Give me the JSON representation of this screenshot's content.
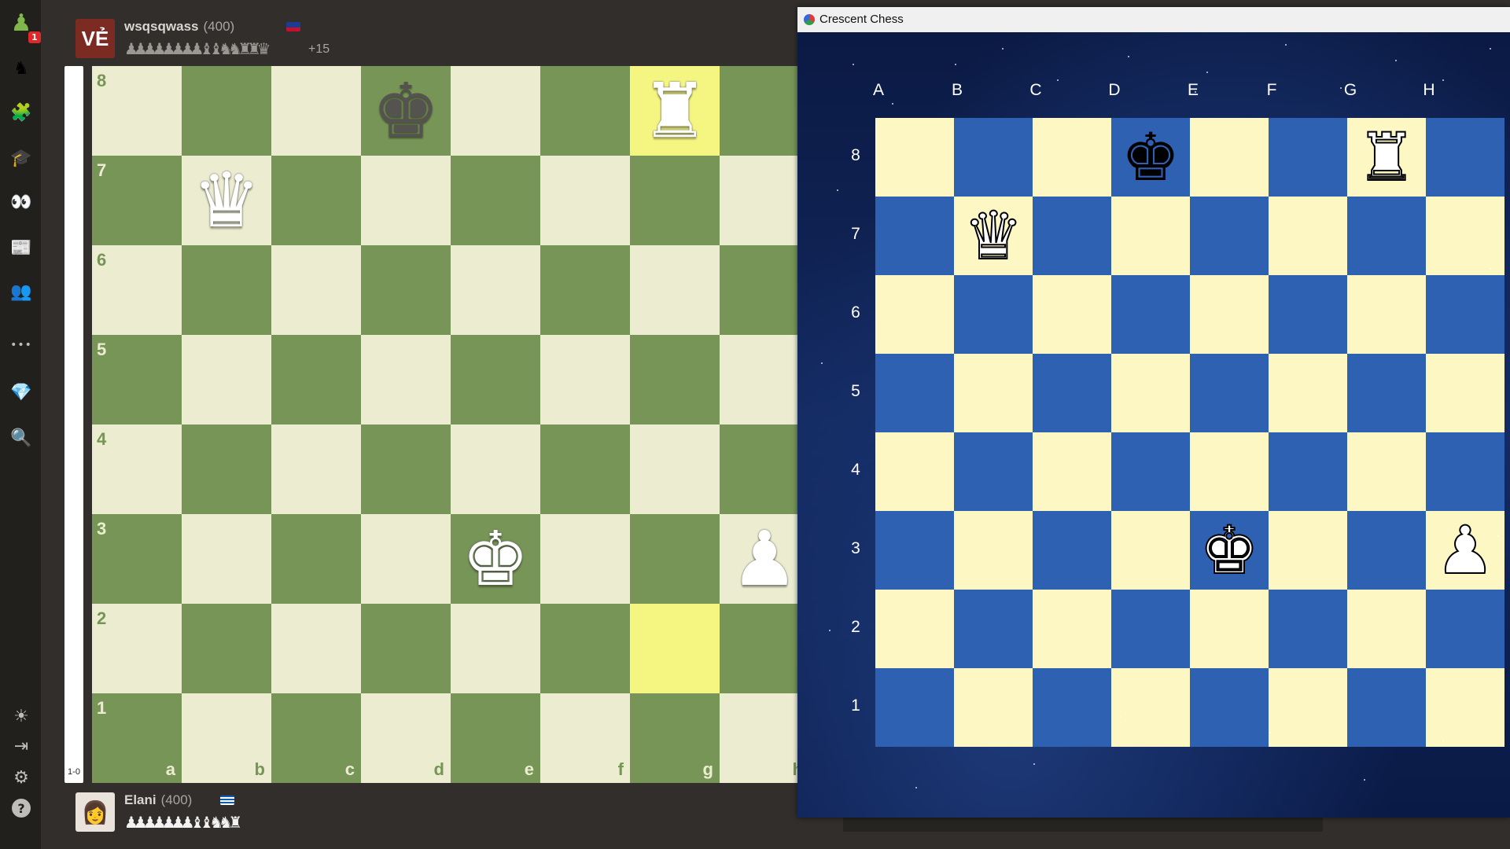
{
  "nav": {
    "badge_count": "1",
    "items": [
      {
        "name": "home-pawn-icon",
        "glyph": "♟"
      },
      {
        "name": "play-icon",
        "glyph": "♞"
      },
      {
        "name": "puzzles-icon",
        "glyph": "🧩"
      },
      {
        "name": "learn-icon",
        "glyph": "🎓"
      },
      {
        "name": "watch-icon",
        "glyph": "👀"
      },
      {
        "name": "news-icon",
        "glyph": "📰"
      },
      {
        "name": "social-icon",
        "glyph": "👥"
      },
      {
        "name": "more-icon",
        "glyph": "•••"
      },
      {
        "name": "premium-diamond-icon",
        "glyph": "💎"
      },
      {
        "name": "search-icon",
        "glyph": "🔍"
      },
      {
        "name": "theme-icon",
        "glyph": "☀"
      },
      {
        "name": "logout-icon",
        "glyph": "⇥"
      },
      {
        "name": "settings-icon",
        "glyph": "⚙"
      },
      {
        "name": "help-icon",
        "glyph": "?"
      }
    ]
  },
  "top_player": {
    "avatar_text": "VẺ",
    "name": "wsqsqwass",
    "rating": "(400)",
    "captured": "♟♟♟♟♟♟♟♟ ♝♝ ♞♞ ♜♜ ♛",
    "advantage": "+15"
  },
  "bottom_player": {
    "avatar_glyph": "👩",
    "name": "Elani",
    "rating": "(400)",
    "captured": "♟♟♟♟♟♟♟ ♝♝ ♞♞ ♜"
  },
  "eval": {
    "label": "1-0"
  },
  "board_green": {
    "files": [
      "a",
      "b",
      "c",
      "d",
      "e",
      "f",
      "g",
      "h"
    ],
    "ranks": [
      "8",
      "7",
      "6",
      "5",
      "4",
      "3",
      "2",
      "1"
    ],
    "highlight_squares": [
      "g8",
      "g2"
    ],
    "pieces": [
      {
        "square": "d8",
        "glyph": "♚",
        "color": "black",
        "piece": "king"
      },
      {
        "square": "g8",
        "glyph": "♜",
        "color": "white",
        "piece": "rook"
      },
      {
        "square": "b7",
        "glyph": "♛",
        "color": "white",
        "piece": "queen"
      },
      {
        "square": "e3",
        "glyph": "♚",
        "color": "white",
        "piece": "king"
      },
      {
        "square": "h3",
        "glyph": "♟",
        "color": "white",
        "piece": "pawn"
      }
    ]
  },
  "crescent": {
    "title": "Crescent Chess",
    "cols": [
      "A",
      "B",
      "C",
      "D",
      "E",
      "F",
      "G",
      "H"
    ],
    "rows": [
      "8",
      "7",
      "6",
      "5",
      "4",
      "3",
      "2",
      "1"
    ],
    "pieces": [
      {
        "square": "D8",
        "glyph": "♚",
        "color": "black",
        "piece": "king"
      },
      {
        "square": "G8",
        "glyph": "♜",
        "color": "white",
        "piece": "rook"
      },
      {
        "square": "B7",
        "glyph": "♛",
        "color": "white",
        "piece": "queen"
      },
      {
        "square": "E3",
        "glyph": "♚",
        "color": "white",
        "piece": "king"
      },
      {
        "square": "H3",
        "glyph": "♟",
        "color": "white",
        "piece": "pawn"
      }
    ]
  },
  "colors": {
    "board_light": "#ebecd0",
    "board_dark": "#779556",
    "highlight": "#f5f682",
    "crescent_light": "#fdf7c3",
    "crescent_dark": "#2f61b3"
  }
}
